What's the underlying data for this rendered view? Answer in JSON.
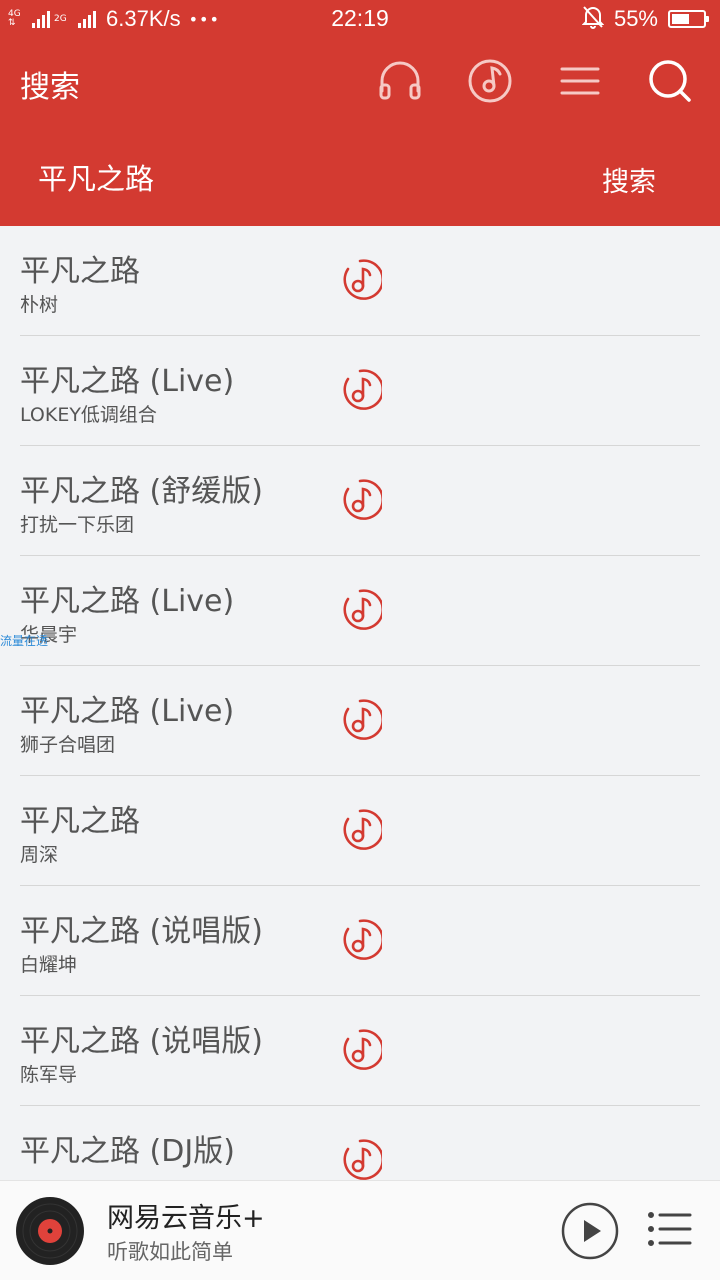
{
  "status_bar": {
    "network_1": "4G",
    "network_2": "4G",
    "network_3": "2G",
    "speed": "6.37K/s",
    "more": "•••",
    "time": "22:19",
    "battery_pct": "55%",
    "battery_level": 0.55
  },
  "header": {
    "title": "搜索",
    "icons": [
      "headphones-icon",
      "music-note-circle-icon",
      "menu-icon",
      "search-icon"
    ],
    "search_query": "平凡之路",
    "search_button": "搜索"
  },
  "results": [
    {
      "title": "平凡之路",
      "artist": "朴树"
    },
    {
      "title": "平凡之路 (Live)",
      "artist": "LOKEY低调组合"
    },
    {
      "title": "平凡之路 (舒缓版)",
      "artist": "打扰一下乐团"
    },
    {
      "title": "平凡之路 (Live)",
      "artist": "华晨宇"
    },
    {
      "title": "平凡之路 (Live)",
      "artist": "狮子合唱团"
    },
    {
      "title": "平凡之路",
      "artist": "周深"
    },
    {
      "title": "平凡之路 (说唱版)",
      "artist": "白耀坤"
    },
    {
      "title": "平凡之路 (说唱版)",
      "artist": "陈军导"
    },
    {
      "title": "平凡之路 (DJ版)",
      "artist": ""
    }
  ],
  "watermark": "流量在透",
  "player": {
    "title": "网易云音乐+",
    "subtitle": "听歌如此简单"
  },
  "colors": {
    "brand_red": "#d33a31",
    "icon_red": "#d33a31",
    "background": "#f2f3f5"
  }
}
